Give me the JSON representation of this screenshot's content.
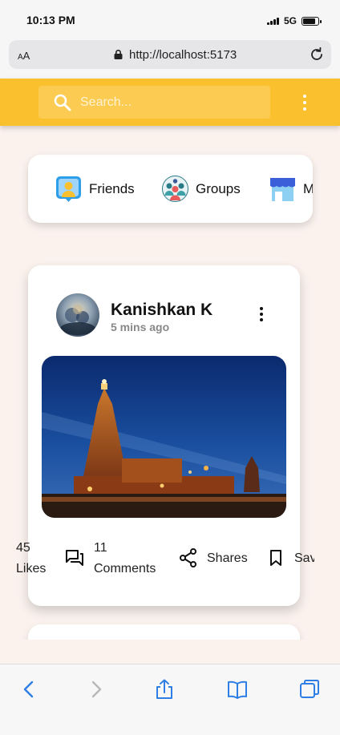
{
  "status_bar": {
    "time": "10:13 PM",
    "network": "5G",
    "battery_level": 0.85
  },
  "browser": {
    "text_size_label": "AA",
    "url": "http://localhost:5173"
  },
  "header": {
    "search_placeholder": "Search...",
    "brand_color": "#fbc02d"
  },
  "shortcuts": [
    {
      "label": "Friends",
      "icon": "friends-icon"
    },
    {
      "label": "Groups",
      "icon": "groups-icon"
    },
    {
      "label": "Marketplace",
      "icon": "marketplace-icon"
    }
  ],
  "post": {
    "author": "Kanishkan K",
    "time": "5 mins ago",
    "image": "temple-photo",
    "likes_count": "45",
    "likes_label": "Likes",
    "comments_count": "11",
    "comments_label": "Comments",
    "shares_label": "Shares",
    "save_label": "Save"
  },
  "toolbar": [
    "back-icon",
    "forward-icon",
    "share-icon",
    "bookmarks-icon",
    "tabs-icon"
  ]
}
